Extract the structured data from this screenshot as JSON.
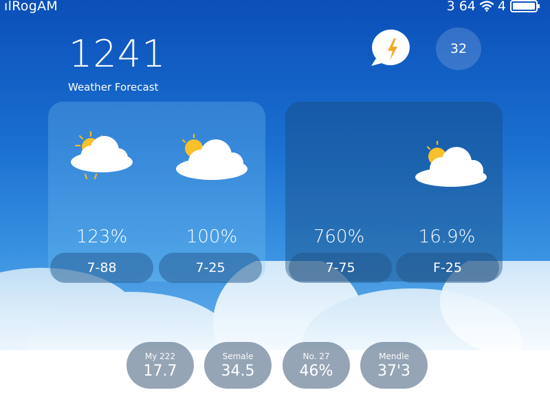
{
  "status_bar": {
    "carrier": "ılRogAM",
    "time": "3 64",
    "network": "4"
  },
  "header": {
    "time_display": "1241",
    "subtitle": "Weather Forecast"
  },
  "header_buttons": {
    "count_badge": "32"
  },
  "icons": {
    "alert": "lightning-bolt-icon",
    "sun_cloud": "sun-cloud-icon",
    "accent_color": "#f5a623"
  },
  "cards": [
    {
      "percent": "123%",
      "range": "7-88",
      "icon": "sun-cloud-icon"
    },
    {
      "percent": "100%",
      "range": "7-25",
      "icon": "sun-cloud-icon"
    },
    {
      "percent": "760%",
      "range": "7-75",
      "icon": ""
    },
    {
      "percent": "16.9%",
      "range": "F-25",
      "icon": "sun-cloud-icon"
    }
  ],
  "stats": [
    {
      "label": "My 222",
      "value": "17.7"
    },
    {
      "label": "Semale",
      "value": "34.5"
    },
    {
      "label": "No. 27",
      "value": "46%"
    },
    {
      "label": "Mendle",
      "value": "37'3"
    }
  ]
}
